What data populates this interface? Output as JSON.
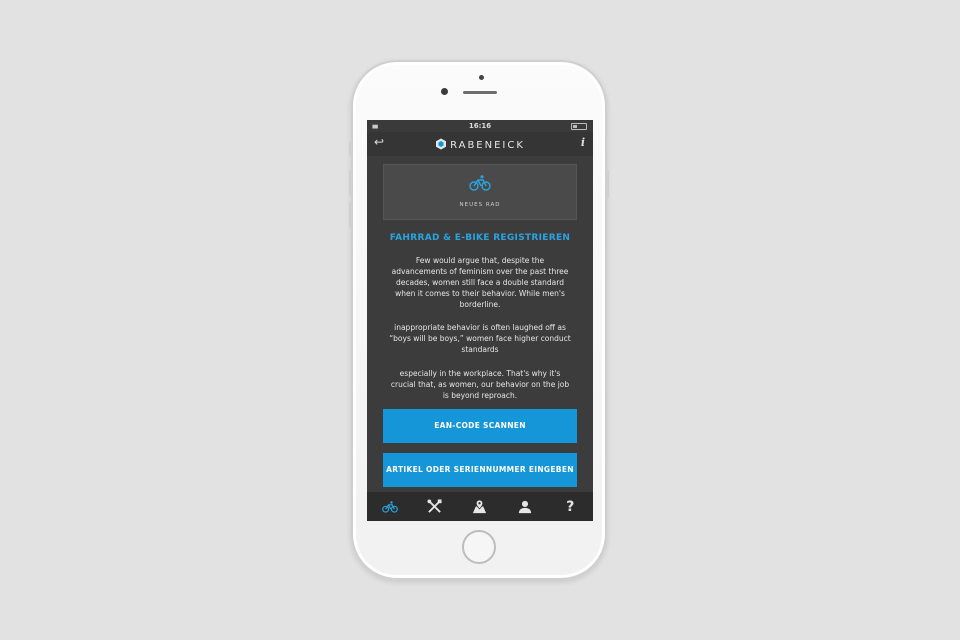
{
  "status_bar": {
    "time": "16:16"
  },
  "nav": {
    "brand": "RABENEICK",
    "info_label": "i"
  },
  "card": {
    "label": "NEUES RAD",
    "icon": "bicycle-icon"
  },
  "title": "FAHRRAD & E-BIKE REGISTRIEREN",
  "paragraphs": [
    "Few would argue that, despite the advancements of feminism over the past three decades, women still face a double standard when it comes to their behavior. While men's borderline.",
    "inappropriate behavior is often laughed off as “boys will be boys,” women face higher conduct standards",
    "especially in the workplace. That's why it's crucial that, as women, our behavior on the job is beyond reproach."
  ],
  "buttons": {
    "scan": "EAN-CODE SCANNEN",
    "enter": "ARTIKEL ODER SERIENNUMMER EINGEBEN"
  },
  "tabs": [
    {
      "icon": "bicycle-icon",
      "active": true
    },
    {
      "icon": "tools-icon",
      "active": false
    },
    {
      "icon": "map-pin-icon",
      "active": false
    },
    {
      "icon": "user-icon",
      "active": false
    },
    {
      "icon": "help-icon",
      "label": "?",
      "active": false
    }
  ],
  "colors": {
    "accent": "#1496d9",
    "title": "#2aa3e0",
    "screen_bg": "#3c3c3c",
    "tabbar_bg": "#2c2c2c"
  }
}
